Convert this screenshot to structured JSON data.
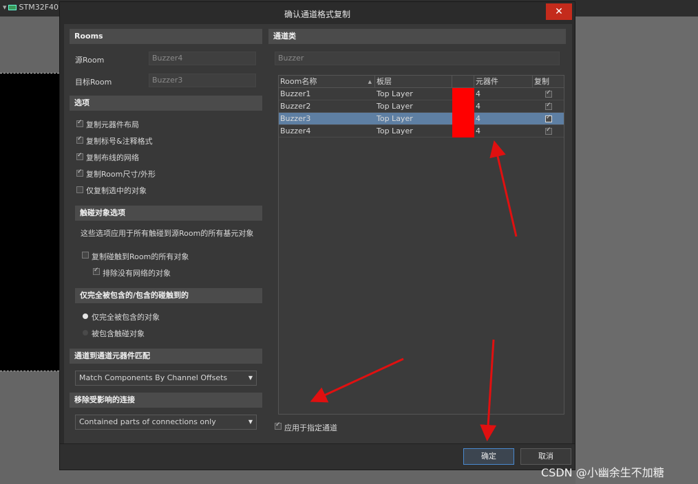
{
  "background": {
    "tab_title": "STM32F407"
  },
  "dialog": {
    "title": "确认通道格式复制",
    "close_glyph": "✕"
  },
  "rooms": {
    "header": "Rooms",
    "source_label": "源Room",
    "source_value": "Buzzer4",
    "target_label": "目标Room",
    "target_value": "Buzzer3"
  },
  "options": {
    "header": "选项",
    "items": [
      {
        "label": "复制元器件布局",
        "checked": true
      },
      {
        "label": "复制标号&注释格式",
        "checked": true
      },
      {
        "label": "复制布线的网络",
        "checked": true
      },
      {
        "label": "复制Room尺寸/外形",
        "checked": true
      },
      {
        "label": "仅复制选中的对象",
        "checked": false
      }
    ]
  },
  "touch": {
    "header": "触碰对象选项",
    "description": "这些选项应用于所有触碰到源Room的所有基元对象",
    "copy_touching": {
      "label": "复制碰触到Room的所有对象",
      "checked": false
    },
    "exclude_no_net": {
      "label": "排除没有网络的对象",
      "checked": true
    }
  },
  "contain": {
    "header": "仅完全被包含的/包含的碰触到的",
    "options": [
      {
        "label": "仅完全被包含的对象",
        "selected": true
      },
      {
        "label": "被包含触碰对象",
        "selected": false
      }
    ]
  },
  "match": {
    "header": "通道到通道元器件匹配",
    "value": "Match Components By Channel Offsets"
  },
  "remove": {
    "header": "移除受影响的连接",
    "value": "Contained parts of connections only"
  },
  "channel_class": {
    "header": "通道类",
    "value": "Buzzer"
  },
  "table": {
    "columns": [
      "Room名称",
      "板层",
      "",
      "元器件",
      "复制"
    ],
    "rows": [
      {
        "name": "Buzzer1",
        "layer": "Top Layer",
        "count": "4",
        "copy": true,
        "selected": false
      },
      {
        "name": "Buzzer2",
        "layer": "Top Layer",
        "count": "4",
        "copy": true,
        "selected": false
      },
      {
        "name": "Buzzer3",
        "layer": "Top Layer",
        "count": "4",
        "copy": true,
        "selected": true
      },
      {
        "name": "Buzzer4",
        "layer": "Top Layer",
        "count": "4",
        "copy": true,
        "selected": false
      }
    ],
    "row_color": "#ff0000",
    "selected_color": "#5e7fa3"
  },
  "apply_to_channel": {
    "label": "应用于指定通道",
    "checked": true
  },
  "buttons": {
    "ok": "确定",
    "cancel": "取消"
  },
  "watermark": "CSDN @小幽余生不加糖",
  "annotation_color": "#e01010"
}
